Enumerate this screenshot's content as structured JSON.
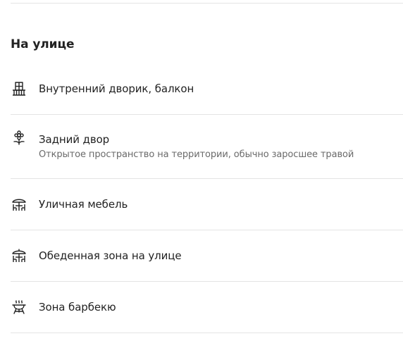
{
  "section": {
    "title": "На улице"
  },
  "items": [
    {
      "icon": "balcony-icon",
      "label": "Внутренний дворик, балкон",
      "sublabel": ""
    },
    {
      "icon": "backyard-icon",
      "label": "Задний двор",
      "sublabel": "Открытое пространство на территории, обычно заросшее травой"
    },
    {
      "icon": "outdoor-furniture-icon",
      "label": "Уличная мебель",
      "sublabel": ""
    },
    {
      "icon": "outdoor-dining-icon",
      "label": "Обеденная зона на улице",
      "sublabel": ""
    },
    {
      "icon": "bbq-grill-icon",
      "label": "Зона барбекю",
      "sublabel": ""
    }
  ]
}
